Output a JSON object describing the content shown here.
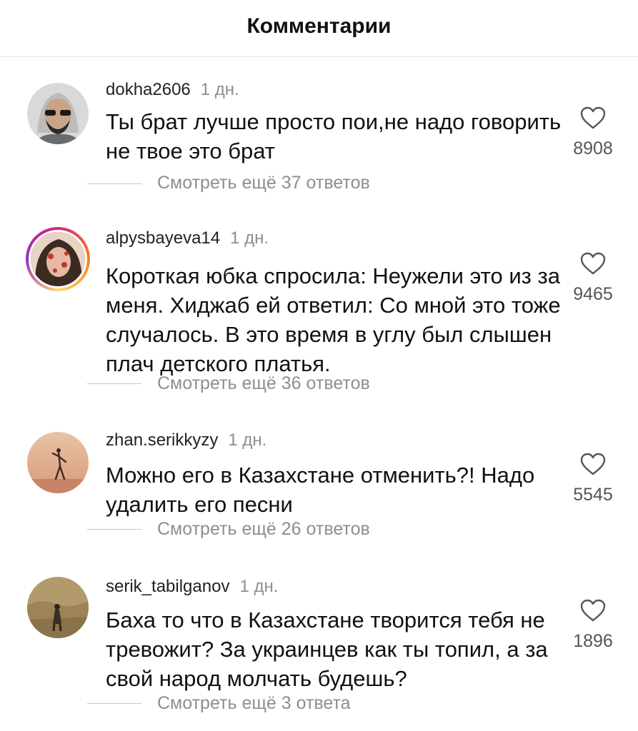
{
  "header": {
    "title": "Комментарии"
  },
  "comments": [
    {
      "username": "dokha2606",
      "time": "1 дн.",
      "text": "Ты брат лучше просто пои,не надо говорить не твое это брат",
      "replies": "Смотреть ещё 37 ответов",
      "likes": "8908"
    },
    {
      "username": "alpysbayeva14",
      "time": "1 дн.",
      "text": "Короткая юбка спросила: Неужели это из за меня. Хиджаб ей ответил: Со мной это тоже случалось. В это время в углу был слышен плач детского платья.",
      "replies": "Смотреть ещё 36 ответов",
      "likes": "9465"
    },
    {
      "username": "zhan.serikkyzy",
      "time": "1 дн.",
      "text": "Можно его в Казахстане отменить?! Надо удалить его песни",
      "replies": "Смотреть ещё 26 ответов",
      "likes": "5545"
    },
    {
      "username": "serik_tabilganov",
      "time": "1 дн.",
      "text": "Баха то что в Казахстане творится тебя не тревожит? За украинцев как ты топил, а за свой народ молчать будешь?",
      "replies": "Смотреть ещё 3 ответа",
      "likes": "1896"
    }
  ]
}
